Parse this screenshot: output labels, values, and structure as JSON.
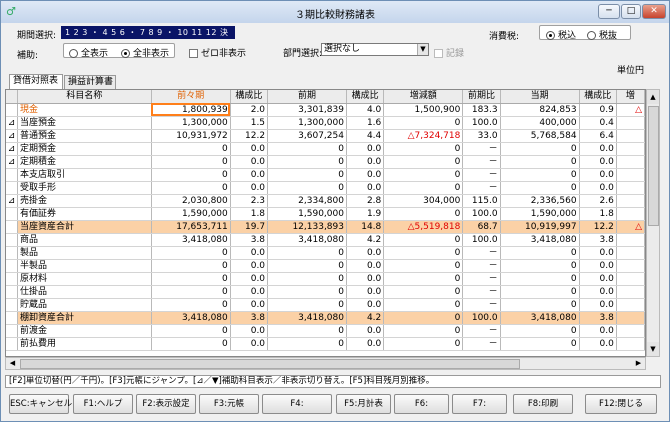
{
  "window": {
    "title": "３期比較財務諸表",
    "min_label": "─",
    "max_label": "□",
    "close_label": "✕"
  },
  "controls": {
    "period_label": "期間選択:",
    "period_value": "1 2 3 ・ 4 5 6 ・ 7 8 9 ・ 10 11 12 決",
    "hojo_label": "補助:",
    "radio_all_show": "全表示",
    "radio_all_hide": "全非表示",
    "zero_hide": "ゼロ非表示",
    "dept_label": "部門選択:",
    "dept_value": "選択なし",
    "memo_label": "記録",
    "tax_label": "消費税:",
    "tax_incl": "税込",
    "tax_excl": "税抜",
    "unit": "単位円"
  },
  "tabs": [
    "貸借対照表",
    "損益計算書"
  ],
  "table": {
    "headers": [
      "",
      "科目名称",
      "前々期",
      "構成比",
      "前期",
      "構成比",
      "増減額",
      "前期比",
      "当期",
      "構成比",
      "増"
    ],
    "rows": [
      {
        "mark": "",
        "name": "現金",
        "c1": "1,800,939",
        "c2": "2.0",
        "c3": "3,301,839",
        "c4": "4.0",
        "c5": "1,500,900",
        "c6": "183.3",
        "c7": "824,853",
        "c8": "0.9",
        "c9": "△",
        "hl": false,
        "sel": true
      },
      {
        "mark": "⊿",
        "name": "当座預金",
        "c1": "1,300,000",
        "c2": "1.5",
        "c3": "1,300,000",
        "c4": "1.6",
        "c5": "0",
        "c6": "100.0",
        "c7": "400,000",
        "c8": "0.4",
        "c9": ""
      },
      {
        "mark": "⊿",
        "name": "普通預金",
        "c1": "10,931,972",
        "c2": "12.2",
        "c3": "3,607,254",
        "c4": "4.4",
        "c5": "△7,324,718",
        "c6": "33.0",
        "c7": "5,768,584",
        "c8": "6.4",
        "c9": "",
        "neg": true
      },
      {
        "mark": "⊿",
        "name": "定期預金",
        "c1": "0",
        "c2": "0.0",
        "c3": "0",
        "c4": "0.0",
        "c5": "0",
        "c6": "－",
        "c7": "0",
        "c8": "0.0",
        "c9": ""
      },
      {
        "mark": "⊿",
        "name": "定期積金",
        "c1": "0",
        "c2": "0.0",
        "c3": "0",
        "c4": "0.0",
        "c5": "0",
        "c6": "－",
        "c7": "0",
        "c8": "0.0",
        "c9": ""
      },
      {
        "mark": "",
        "name": "本支店取引",
        "c1": "0",
        "c2": "0.0",
        "c3": "0",
        "c4": "0.0",
        "c5": "0",
        "c6": "－",
        "c7": "0",
        "c8": "0.0",
        "c9": ""
      },
      {
        "mark": "",
        "name": "受取手形",
        "c1": "0",
        "c2": "0.0",
        "c3": "0",
        "c4": "0.0",
        "c5": "0",
        "c6": "－",
        "c7": "0",
        "c8": "0.0",
        "c9": ""
      },
      {
        "mark": "⊿",
        "name": "売掛金",
        "c1": "2,030,800",
        "c2": "2.3",
        "c3": "2,334,800",
        "c4": "2.8",
        "c5": "304,000",
        "c6": "115.0",
        "c7": "2,336,560",
        "c8": "2.6",
        "c9": ""
      },
      {
        "mark": "",
        "name": "有価証券",
        "c1": "1,590,000",
        "c2": "1.8",
        "c3": "1,590,000",
        "c4": "1.9",
        "c5": "0",
        "c6": "100.0",
        "c7": "1,590,000",
        "c8": "1.8",
        "c9": ""
      },
      {
        "mark": "",
        "name": "当座資産合計",
        "c1": "17,653,711",
        "c2": "19.7",
        "c3": "12,133,893",
        "c4": "14.8",
        "c5": "△5,519,818",
        "c6": "68.7",
        "c7": "10,919,997",
        "c8": "12.2",
        "c9": "△",
        "hl": true,
        "neg": true
      },
      {
        "mark": "",
        "name": "商品",
        "c1": "3,418,080",
        "c2": "3.8",
        "c3": "3,418,080",
        "c4": "4.2",
        "c5": "0",
        "c6": "100.0",
        "c7": "3,418,080",
        "c8": "3.8",
        "c9": ""
      },
      {
        "mark": "",
        "name": "製品",
        "c1": "0",
        "c2": "0.0",
        "c3": "0",
        "c4": "0.0",
        "c5": "0",
        "c6": "－",
        "c7": "0",
        "c8": "0.0",
        "c9": ""
      },
      {
        "mark": "",
        "name": "半製品",
        "c1": "0",
        "c2": "0.0",
        "c3": "0",
        "c4": "0.0",
        "c5": "0",
        "c6": "－",
        "c7": "0",
        "c8": "0.0",
        "c9": ""
      },
      {
        "mark": "",
        "name": "原材料",
        "c1": "0",
        "c2": "0.0",
        "c3": "0",
        "c4": "0.0",
        "c5": "0",
        "c6": "－",
        "c7": "0",
        "c8": "0.0",
        "c9": ""
      },
      {
        "mark": "",
        "name": "仕掛品",
        "c1": "0",
        "c2": "0.0",
        "c3": "0",
        "c4": "0.0",
        "c5": "0",
        "c6": "－",
        "c7": "0",
        "c8": "0.0",
        "c9": ""
      },
      {
        "mark": "",
        "name": "貯蔵品",
        "c1": "0",
        "c2": "0.0",
        "c3": "0",
        "c4": "0.0",
        "c5": "0",
        "c6": "－",
        "c7": "0",
        "c8": "0.0",
        "c9": ""
      },
      {
        "mark": "",
        "name": "棚卸資産合計",
        "c1": "3,418,080",
        "c2": "3.8",
        "c3": "3,418,080",
        "c4": "4.2",
        "c5": "0",
        "c6": "100.0",
        "c7": "3,418,080",
        "c8": "3.8",
        "c9": "",
        "hl": true
      },
      {
        "mark": "",
        "name": "前渡金",
        "c1": "0",
        "c2": "0.0",
        "c3": "0",
        "c4": "0.0",
        "c5": "0",
        "c6": "－",
        "c7": "0",
        "c8": "0.0",
        "c9": ""
      },
      {
        "mark": "",
        "name": "前払費用",
        "c1": "0",
        "c2": "0.0",
        "c3": "0",
        "c4": "0.0",
        "c5": "0",
        "c6": "－",
        "c7": "0",
        "c8": "0.0",
        "c9": ""
      }
    ]
  },
  "status": "[F2]単位切替(円／千円)。[F3]元帳にジャンプ。[⊿／▼]補助科目表示／非表示切り替え。[F5]科目残月別推移。",
  "fkeys": [
    "ESC:キャンセル",
    "F1:ヘルプ",
    "F2:表示設定",
    "F3:元帳",
    "F4:",
    "F5:月計表",
    "F6:",
    "F7:",
    "F8:印刷",
    "F12:閉じる"
  ]
}
